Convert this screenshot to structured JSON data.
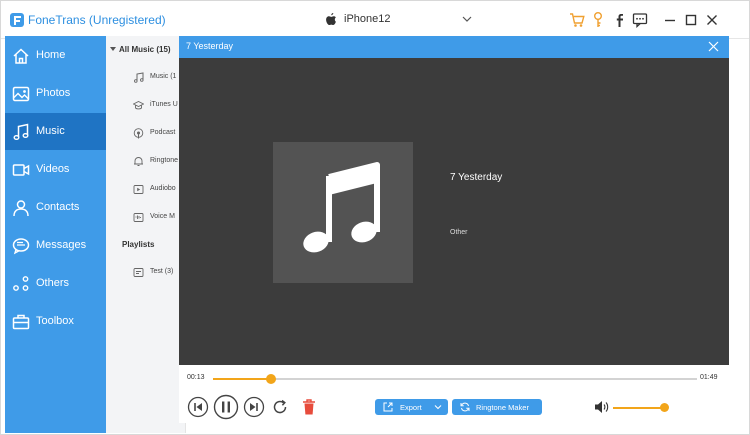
{
  "app": {
    "title": "FoneTrans (Unregistered)"
  },
  "device": {
    "name": "iPhone12"
  },
  "toolbar_icons": [
    "cart-icon",
    "key-icon",
    "facebook-icon",
    "chat-icon",
    "minimize-icon",
    "maximize-icon",
    "close-icon"
  ],
  "sidebar": {
    "items": [
      {
        "label": "Home",
        "icon": "home-icon"
      },
      {
        "label": "Photos",
        "icon": "photos-icon"
      },
      {
        "label": "Music",
        "icon": "music-icon",
        "active": true
      },
      {
        "label": "Videos",
        "icon": "videos-icon"
      },
      {
        "label": "Contacts",
        "icon": "contacts-icon"
      },
      {
        "label": "Messages",
        "icon": "messages-icon"
      },
      {
        "label": "Others",
        "icon": "others-icon"
      },
      {
        "label": "Toolbox",
        "icon": "toolbox-icon"
      }
    ]
  },
  "categories": {
    "header": "All Music (15)",
    "items": [
      {
        "label": "Music (1",
        "icon": "note-icon"
      },
      {
        "label": "iTunes U",
        "icon": "graduation-cap-icon"
      },
      {
        "label": "Podcast",
        "icon": "podcast-icon"
      },
      {
        "label": "Ringtone",
        "icon": "bell-icon"
      },
      {
        "label": "Audiobo",
        "icon": "audiobook-icon"
      },
      {
        "label": "Voice M",
        "icon": "voice-memo-icon"
      }
    ],
    "playlists_header": "Playlists",
    "playlists": [
      {
        "label": "Test (3)",
        "icon": "playlist-icon"
      }
    ]
  },
  "player": {
    "title": "7  Yesterday",
    "track_name": "7  Yesterday",
    "artist": "Other",
    "current_time": "00:13",
    "duration": "01:49",
    "progress": 0.12,
    "volume": 0.95,
    "export_label": "Export",
    "ringtone_label": "Ringtone Maker"
  },
  "colors": {
    "accent": "#3f9be8",
    "accent_dark": "#1f74c4",
    "progress": "#f2a51a",
    "stage_bg": "#3c3c3c",
    "art_bg": "#535353",
    "delete": "#e74c3c",
    "toolbar_orange": "#f0a030"
  }
}
